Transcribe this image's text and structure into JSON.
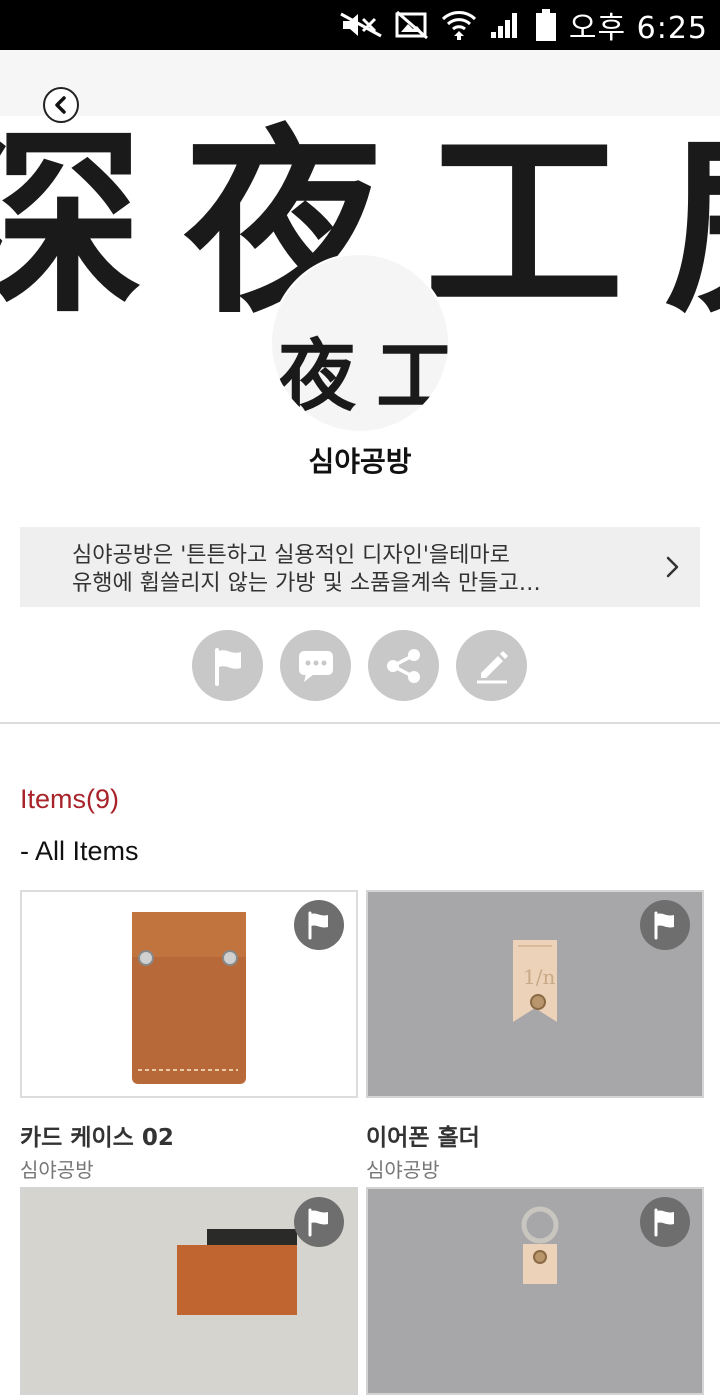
{
  "status_bar": {
    "time": "오후 6:25",
    "icons": [
      "mute-icon",
      "no-image-icon",
      "wifi-icon",
      "signal-icon",
      "battery-icon"
    ]
  },
  "header": {
    "back_icon": "chevron-left-icon"
  },
  "banner": {
    "glyphs": [
      "深",
      "夜",
      "工",
      "房"
    ]
  },
  "avatar": {
    "glyphs": [
      "夜",
      "工"
    ]
  },
  "shop": {
    "name": "심야공방",
    "description_line1": "심야공방은 '튼튼하고 실용적인 디자인'을테마로",
    "description_line2": "유행에 휩쓸리지 않는 가방 및 소품을계속 만들고…"
  },
  "actions": [
    {
      "icon": "flag-icon"
    },
    {
      "icon": "message-icon"
    },
    {
      "icon": "share-icon"
    },
    {
      "icon": "edit-icon"
    }
  ],
  "items_section": {
    "heading": "Items(9)",
    "category": "- All Items"
  },
  "products": [
    {
      "title": "카드 케이스 02",
      "seller": "심야공방"
    },
    {
      "title": "이어폰 홀더",
      "seller": "심야공방"
    },
    {
      "title": "",
      "seller": ""
    },
    {
      "title": "",
      "seller": ""
    }
  ],
  "colors": {
    "accent": "#a8232a",
    "button_grey": "#c8c8c8",
    "badge_grey": "#6e6e6e"
  }
}
